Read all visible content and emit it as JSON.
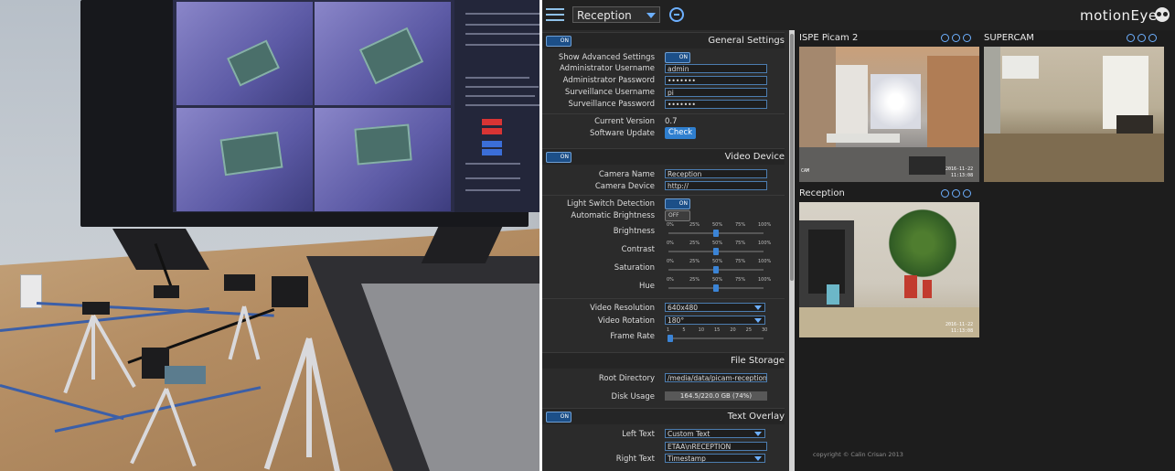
{
  "topbar": {
    "camera_select_value": "Reception",
    "brand": "motionEye"
  },
  "general_settings": {
    "title": "General Settings",
    "toggle": "ON",
    "show_advanced_label": "Show Advanced Settings",
    "show_advanced_toggle": "ON",
    "admin_user_label": "Administrator Username",
    "admin_user_value": "admin",
    "admin_pass_label": "Administrator Password",
    "admin_pass_value": "•••••••",
    "surv_user_label": "Surveillance Username",
    "surv_user_value": "pi",
    "surv_pass_label": "Surveillance Password",
    "surv_pass_value": "•••••••",
    "version_label": "Current Version",
    "version_value": "0.7",
    "update_label": "Software Update",
    "check_button": "Check"
  },
  "video_device": {
    "title": "Video Device",
    "toggle": "ON",
    "camera_name_label": "Camera Name",
    "camera_name_value": "Reception",
    "camera_device_label": "Camera Device",
    "camera_device_value": "http://",
    "light_switch_label": "Light Switch Detection",
    "light_switch_toggle": "ON",
    "auto_brightness_label": "Automatic Brightness",
    "auto_brightness_toggle": "OFF",
    "brightness_label": "Brightness",
    "contrast_label": "Contrast",
    "saturation_label": "Saturation",
    "hue_label": "Hue",
    "percent_ticks": [
      "0%",
      "25%",
      "50%",
      "75%",
      "100%"
    ],
    "brightness": 0.5,
    "contrast": 0.5,
    "saturation": 0.5,
    "hue": 0.5,
    "resolution_label": "Video Resolution",
    "resolution_value": "640x480",
    "rotation_label": "Video Rotation",
    "rotation_value": "180°",
    "frame_rate_label": "Frame Rate",
    "frame_rate_ticks": [
      "1",
      "5",
      "10",
      "15",
      "20",
      "25",
      "30"
    ],
    "frame_rate": 1
  },
  "file_storage": {
    "title": "File Storage",
    "root_dir_label": "Root Directory",
    "root_dir_value": "/media/data/picam-reception",
    "disk_usage_label": "Disk Usage",
    "disk_usage_value": "164.5/220.0 GB (74%)"
  },
  "text_overlay": {
    "title": "Text Overlay",
    "toggle": "ON",
    "left_text_label": "Left Text",
    "left_text_value": "Custom Text",
    "custom_text_value": "ETAA\\nRECEPTION",
    "right_text_label": "Right Text",
    "right_text_value": "Timestamp"
  },
  "cameras": [
    {
      "name": "ISPE Picam 2",
      "date": "2016-11-22",
      "time": "11:13:08"
    },
    {
      "name": "SUPERCAM"
    },
    {
      "name": "Reception",
      "date": "2016-11-22",
      "time": "11:13:08"
    }
  ],
  "footer": {
    "copyright": "copyright © Calin Crisan 2013"
  }
}
